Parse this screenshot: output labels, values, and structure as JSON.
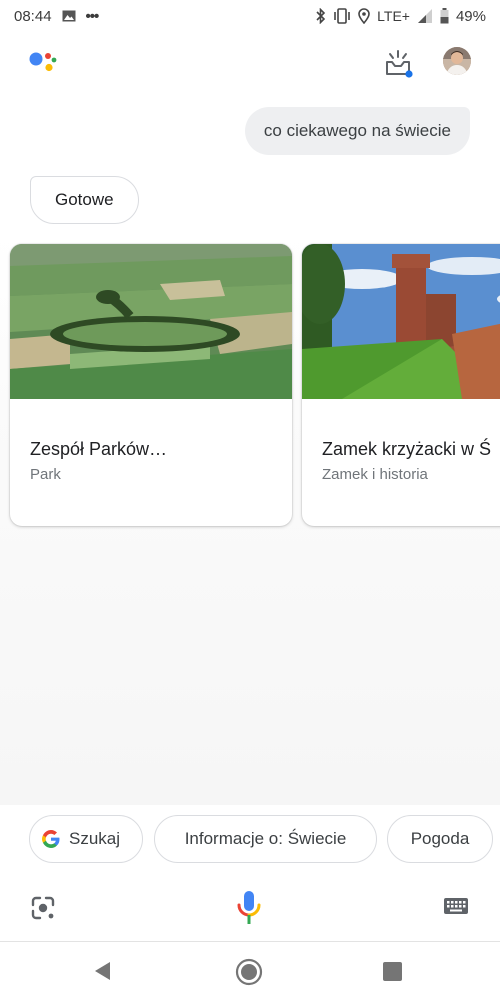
{
  "status_bar": {
    "time": "08:44",
    "notif_dots": "•••",
    "network": "LTE+",
    "battery": "49%",
    "icons": [
      "image-icon",
      "bluetooth-icon",
      "vibrate-icon",
      "location-icon",
      "signal-icon",
      "battery-icon"
    ]
  },
  "assistant": {
    "logo_colors": [
      "#4285F4",
      "#EA4335",
      "#FBBC05",
      "#34A853"
    ],
    "updates_icon": "updates-tray-icon",
    "updates_dot_color": "#1a73e8"
  },
  "conversation": {
    "user_query": "co ciekawego na świecie",
    "assistant_reply": "Gotowe"
  },
  "cards": [
    {
      "title": "Zespół Parków…",
      "subtitle": "Park",
      "image": "aerial-fields-park-image"
    },
    {
      "title": "Zamek krzyżacki w Ś",
      "subtitle": "Zamek i historia",
      "image": "castle-tower-image"
    }
  ],
  "chips": [
    {
      "label": "Szukaj",
      "icon": "google-g-icon"
    },
    {
      "label": "Informacje o: Świecie"
    },
    {
      "label": "Pogoda"
    }
  ],
  "input_bar": {
    "lens_icon": "lens-icon",
    "mic_icon": "microphone-icon",
    "keyboard_icon": "keyboard-icon"
  },
  "nav": [
    "back-icon",
    "home-icon",
    "recents-icon"
  ]
}
